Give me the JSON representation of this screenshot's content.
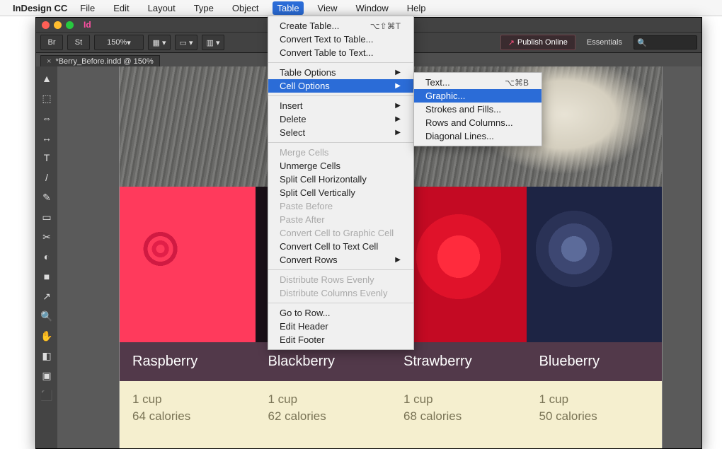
{
  "mac_menu": {
    "apple": "",
    "app": "InDesign CC",
    "items": [
      "File",
      "Edit",
      "Layout",
      "Type",
      "Object",
      "Table",
      "View",
      "Window",
      "Help"
    ],
    "open_index": 5
  },
  "controlbar": {
    "zoom": "150%",
    "publish": "Publish Online",
    "workspace": "Essentials"
  },
  "tab": {
    "name": "*Berry_Before.indd @ 150%"
  },
  "table_menu": {
    "items": [
      {
        "label": "Create Table...",
        "shortcut": "⌥⇧⌘T"
      },
      {
        "label": "Convert Text to Table..."
      },
      {
        "label": "Convert Table to Text..."
      },
      {
        "sep": true
      },
      {
        "label": "Table Options",
        "arrow": true
      },
      {
        "label": "Cell Options",
        "arrow": true,
        "hl": true
      },
      {
        "sep": true
      },
      {
        "label": "Insert",
        "arrow": true
      },
      {
        "label": "Delete",
        "arrow": true
      },
      {
        "label": "Select",
        "arrow": true
      },
      {
        "sep": true
      },
      {
        "label": "Merge Cells",
        "disabled": true
      },
      {
        "label": "Unmerge Cells"
      },
      {
        "label": "Split Cell Horizontally"
      },
      {
        "label": "Split Cell Vertically"
      },
      {
        "label": "Paste Before",
        "disabled": true
      },
      {
        "label": "Paste After",
        "disabled": true
      },
      {
        "label": "Convert Cell to Graphic Cell",
        "disabled": true
      },
      {
        "label": "Convert Cell to Text Cell"
      },
      {
        "label": "Convert Rows",
        "arrow": true
      },
      {
        "sep": true
      },
      {
        "label": "Distribute Rows Evenly",
        "disabled": true
      },
      {
        "label": "Distribute Columns Evenly",
        "disabled": true
      },
      {
        "sep": true
      },
      {
        "label": "Go to Row..."
      },
      {
        "label": "Edit Header"
      },
      {
        "label": "Edit Footer"
      }
    ]
  },
  "cell_options_menu": {
    "items": [
      {
        "label": "Text...",
        "shortcut": "⌥⌘B"
      },
      {
        "label": "Graphic...",
        "hl": true
      },
      {
        "label": "Strokes and Fills..."
      },
      {
        "label": "Rows and Columns..."
      },
      {
        "label": "Diagonal Lines..."
      }
    ]
  },
  "berries": [
    {
      "name": "Raspberry",
      "serving": "1 cup",
      "cal": "64 calories"
    },
    {
      "name": "Blackberry",
      "serving": "1 cup",
      "cal": "62 calories"
    },
    {
      "name": "Strawberry",
      "serving": "1 cup",
      "cal": "68 calories"
    },
    {
      "name": "Blueberry",
      "serving": "1 cup",
      "cal": "50 calories"
    }
  ],
  "tool_glyphs": [
    "▲",
    "⬚",
    "⇔",
    "↔",
    "T",
    "/",
    "✎",
    "▭",
    "✂",
    "◐",
    "■",
    "↗",
    "🔍",
    "✋",
    "◧",
    "▣",
    "⬛"
  ]
}
